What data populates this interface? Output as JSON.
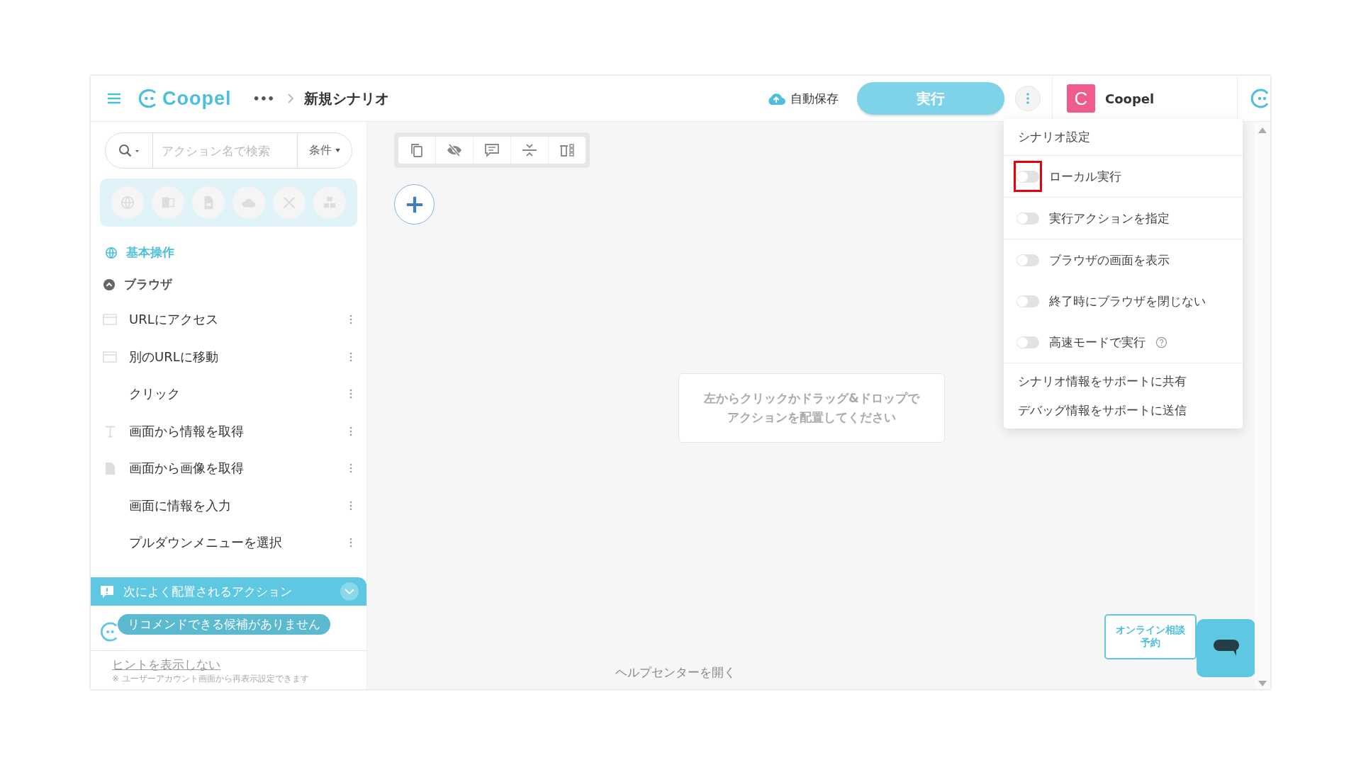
{
  "header": {
    "logo": "Coopel",
    "breadcrumb_more": "•••",
    "title": "新規シナリオ",
    "autosave": "自動保存",
    "run_button": "実行",
    "account": {
      "initial": "C",
      "name": "Coopel"
    }
  },
  "sidebar": {
    "search": {
      "placeholder": "アクション名で検索",
      "condition": "条件"
    },
    "group": "基本操作",
    "subgroup": {
      "label": "ブラウザ",
      "expanded": true
    },
    "actions": [
      {
        "label": "URLにアクセス",
        "kind": "window"
      },
      {
        "label": "別のURLに移動",
        "kind": "window"
      },
      {
        "label": "クリック",
        "kind": "none"
      },
      {
        "label": "画面から情報を取得",
        "kind": "text"
      },
      {
        "label": "画面から画像を取得",
        "kind": "file"
      },
      {
        "label": "画面に情報を入力",
        "kind": "none"
      },
      {
        "label": "プルダウンメニューを選択",
        "kind": "none"
      }
    ],
    "recommend": {
      "title": "次によく配置されるアクション",
      "message": "リコメンドできる候補がありません"
    },
    "hint": {
      "link": "ヒントを表示しない",
      "note": "※ ユーザーアカウント画面から再表示設定できます"
    }
  },
  "canvas": {
    "empty_hint": [
      "左からクリックかドラッグ&ドロップで",
      "アクションを配置してください"
    ],
    "help_link": "ヘルプセンターを開く"
  },
  "menu": {
    "title": "シナリオ設定",
    "toggles": [
      {
        "label": "ローカル実行",
        "on": false,
        "highlighted": true,
        "help": false
      },
      {
        "label": "実行アクションを指定",
        "on": false,
        "highlighted": false,
        "help": false
      },
      {
        "label": "ブラウザの画面を表示",
        "on": false,
        "highlighted": false,
        "help": false
      },
      {
        "label": "終了時にブラウザを閉じない",
        "on": false,
        "highlighted": false,
        "help": false
      },
      {
        "label": "高速モードで実行",
        "on": false,
        "highlighted": false,
        "help": true
      }
    ],
    "links": [
      "シナリオ情報をサポートに共有",
      "デバッグ情報をサポートに送信"
    ]
  },
  "consult_button": [
    "オンライン相談",
    "予約"
  ]
}
